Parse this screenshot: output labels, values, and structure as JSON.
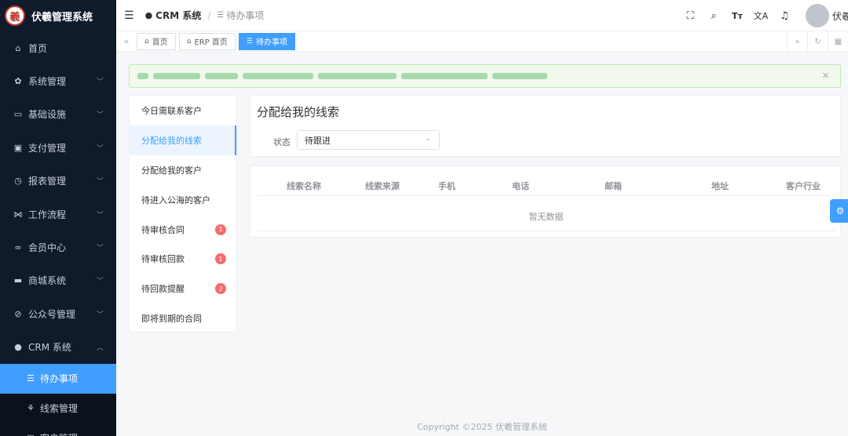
{
  "app": {
    "title": "伏羲管理系统",
    "logo_char": "羲"
  },
  "sidebar": {
    "items": [
      {
        "label": "首页",
        "icon": "home-icon",
        "glyph": "⌂",
        "has_chevron": false
      },
      {
        "label": "系统管理",
        "icon": "gear-icon",
        "glyph": "✿",
        "has_chevron": true
      },
      {
        "label": "基础设施",
        "icon": "monitor-icon",
        "glyph": "▭",
        "has_chevron": true
      },
      {
        "label": "支付管理",
        "icon": "wallet-icon",
        "glyph": "▣",
        "has_chevron": true
      },
      {
        "label": "报表管理",
        "icon": "clock-icon",
        "glyph": "◷",
        "has_chevron": true
      },
      {
        "label": "工作流程",
        "icon": "workflow-icon",
        "glyph": "⋈",
        "has_chevron": true
      },
      {
        "label": "会员中心",
        "icon": "bicycle-icon",
        "glyph": "∞",
        "has_chevron": true
      },
      {
        "label": "商城系统",
        "icon": "shop-icon",
        "glyph": "▬",
        "has_chevron": true
      },
      {
        "label": "公众号管理",
        "icon": "compass-icon",
        "glyph": "⊘",
        "has_chevron": true
      },
      {
        "label": "CRM 系统",
        "icon": "user-icon",
        "glyph": "●",
        "has_chevron": true,
        "expanded": true
      }
    ],
    "sub_items": [
      {
        "label": "待办事项",
        "icon": "list-icon",
        "glyph": "☰",
        "active": true
      },
      {
        "label": "线索管理",
        "icon": "sprout-icon",
        "glyph": "⚘",
        "active": false
      },
      {
        "label": "客户管理",
        "icon": "customer-icon",
        "glyph": "▢",
        "active": false
      }
    ]
  },
  "header": {
    "breadcrumb_root": "CRM 系统",
    "breadcrumb_current": "待办事项",
    "user_name": "伏羲"
  },
  "tabs": [
    {
      "label": "首页",
      "icon": "home-icon",
      "active": false
    },
    {
      "label": "ERP 首页",
      "icon": "home-icon",
      "active": false
    },
    {
      "label": "待办事项",
      "icon": "list-icon",
      "active": true
    }
  ],
  "todo_list": [
    {
      "label": "今日需联系客户",
      "badge": "",
      "active": false
    },
    {
      "label": "分配给我的线索",
      "badge": "",
      "active": true
    },
    {
      "label": "分配给我的客户",
      "badge": "",
      "active": false
    },
    {
      "label": "待进入公海的客户",
      "badge": "",
      "active": false
    },
    {
      "label": "待审核合同",
      "badge": "1",
      "active": false
    },
    {
      "label": "待审核回款",
      "badge": "1",
      "active": false
    },
    {
      "label": "待回款提醒",
      "badge": "2",
      "active": false
    },
    {
      "label": "即将到期的合同",
      "badge": "",
      "active": false
    }
  ],
  "main": {
    "title": "分配给我的线索",
    "filter_label": "状态",
    "filter_value": "待跟进"
  },
  "table": {
    "columns": [
      "线索名称",
      "线索来源",
      "手机",
      "电话",
      "邮箱",
      "地址",
      "客户行业"
    ],
    "empty_text": "暂无数据"
  },
  "footer": {
    "copyright": "Copyright ©2025 伏羲管理系统"
  },
  "colors": {
    "sidebar_bg": "#0f1a2a",
    "accent": "#409eff",
    "badge": "#f56c6c",
    "alert_bg": "#f0f9eb"
  }
}
